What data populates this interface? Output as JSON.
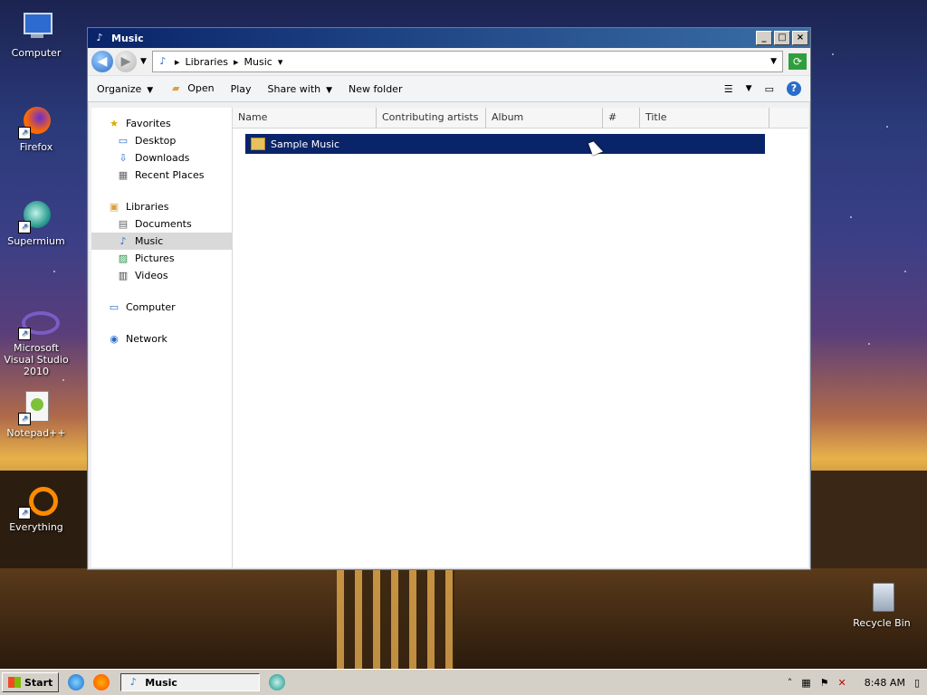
{
  "desktop_icons": [
    {
      "label": "Computer",
      "icon": "computer-icon"
    },
    {
      "label": "Firefox",
      "icon": "firefox-icon"
    },
    {
      "label": "Supermium",
      "icon": "supermium-icon"
    },
    {
      "label": "Microsoft Visual Studio 2010",
      "icon": "visual-studio-icon"
    },
    {
      "label": "Notepad++",
      "icon": "notepadpp-icon"
    },
    {
      "label": "Everything",
      "icon": "everything-icon"
    },
    {
      "label": "Recycle Bin",
      "icon": "recycle-bin-icon"
    }
  ],
  "window": {
    "title": "Music",
    "address": {
      "crumbs": [
        "Libraries",
        "Music"
      ]
    },
    "toolbar": {
      "organize": "Organize",
      "open": "Open",
      "play": "Play",
      "share_with": "Share with",
      "new_folder": "New folder"
    },
    "nav": {
      "favorites": {
        "label": "Favorites",
        "items": [
          "Desktop",
          "Downloads",
          "Recent Places"
        ]
      },
      "libraries": {
        "label": "Libraries",
        "items": [
          "Documents",
          "Music",
          "Pictures",
          "Videos"
        ]
      },
      "computer": "Computer",
      "network": "Network"
    },
    "columns": [
      "Name",
      "Contributing artists",
      "Album",
      "#",
      "Title"
    ],
    "rows": [
      "Sample Music"
    ]
  },
  "taskbar": {
    "start": "Start",
    "task": "Music",
    "time": "8:48 AM"
  },
  "colors": {
    "selection": "#0a246a",
    "titlebar_start": "#0a246a",
    "titlebar_end": "#3a6ea5"
  }
}
